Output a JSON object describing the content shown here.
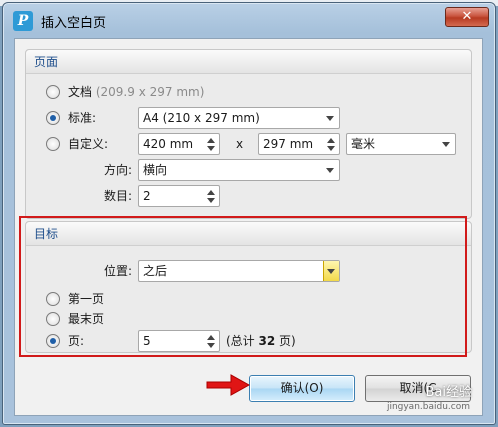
{
  "window": {
    "title": "插入空白页",
    "close_glyph": "✕",
    "app_icon_letter": "P"
  },
  "page_group": {
    "header": "页面",
    "options": {
      "document": {
        "label": "文档",
        "detail": "(209.9 x 297 mm)",
        "checked": false
      },
      "standard": {
        "label": "标准:",
        "value": "A4 (210 x 297 mm)",
        "checked": true
      },
      "custom": {
        "label": "自定义:",
        "width": "420 mm",
        "times": "x",
        "height": "297 mm",
        "unit": "毫米",
        "checked": false
      }
    },
    "orientation": {
      "label": "方向:",
      "value": "横向"
    },
    "count": {
      "label": "数目:",
      "value": "2"
    }
  },
  "target_group": {
    "header": "目标",
    "position": {
      "label": "位置:",
      "value": "之后"
    },
    "options": {
      "first": {
        "label": "第一页",
        "checked": false
      },
      "last": {
        "label": "最末页",
        "checked": false
      },
      "page": {
        "label": "页:",
        "value": "5",
        "checked": true
      }
    },
    "total": {
      "prefix": "(总计 ",
      "count": "32",
      "suffix": " 页)"
    }
  },
  "buttons": {
    "ok": "确认(O)",
    "cancel": "取消(C"
  },
  "watermark": {
    "text": "Bai经验",
    "url": "jingyan.baidu.com"
  },
  "colors": {
    "highlight_box": "#d11a1a",
    "pointer_arrow": "#e01515",
    "group_header_text": "#1f4f8c"
  }
}
